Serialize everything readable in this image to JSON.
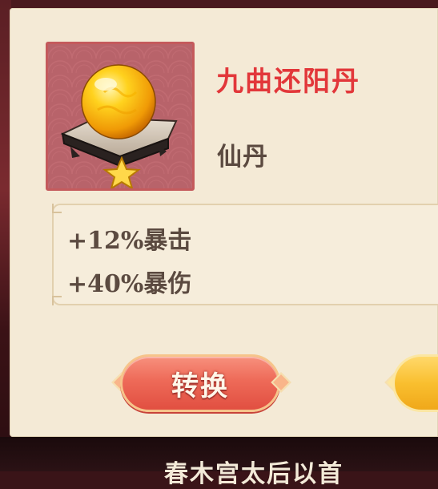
{
  "item": {
    "name": "九曲还阳丹",
    "type": "仙丹",
    "icon": "golden-elixir-orb-icon",
    "rarity_icon": "gold-star-icon"
  },
  "stats": [
    "+12%暴击",
    "+40%暴伤"
  ],
  "buttons": {
    "convert_label": "转换"
  },
  "background": {
    "bottom_text": "春木宫太后以首"
  },
  "colors": {
    "name": "#e2373a",
    "text": "#5b4a40",
    "panel": "#f4ead6",
    "convert_button": "#ee6a58",
    "confirm_button": "#f9bf2f"
  }
}
